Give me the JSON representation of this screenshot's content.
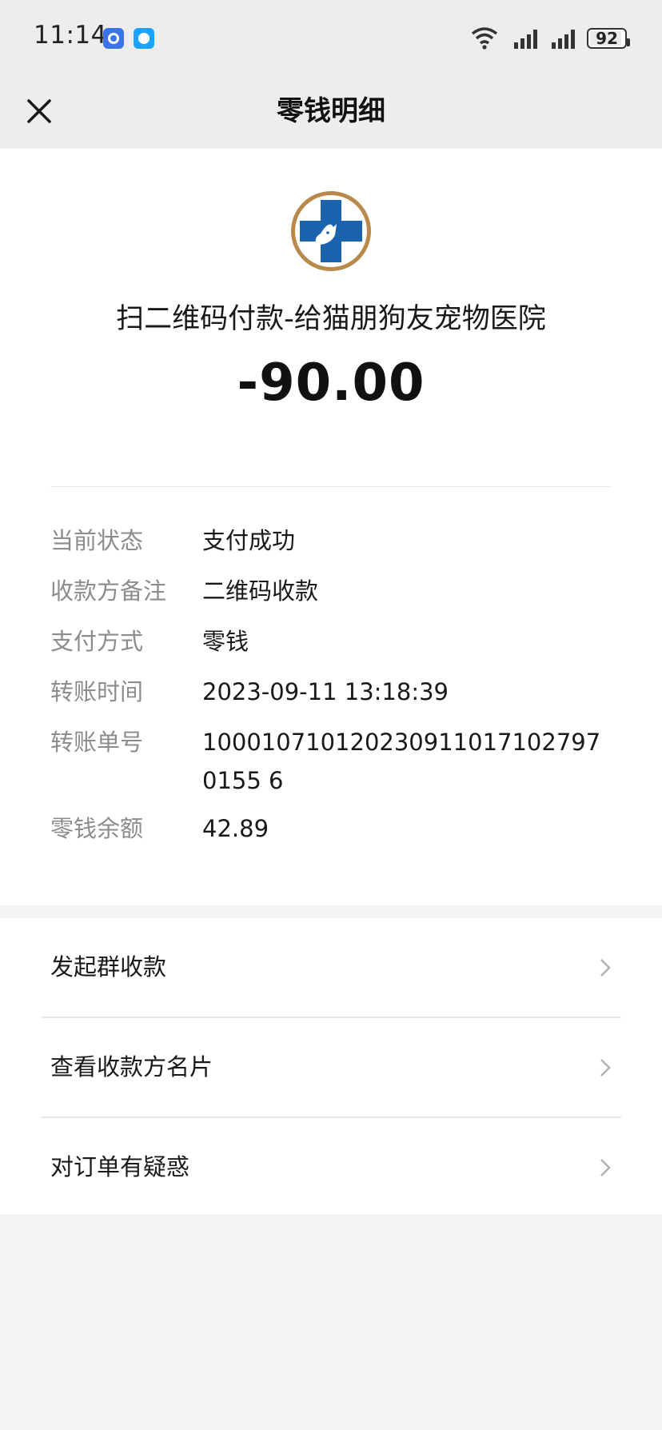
{
  "status_bar": {
    "time": "11:14",
    "battery": "92",
    "battery_level": 0.92,
    "notification_icons": [
      "app-shield-icon",
      "chat-bubble-icon"
    ]
  },
  "nav": {
    "title": "零钱明细",
    "close_icon": "close-icon"
  },
  "transaction": {
    "merchant_logo_icon": "pet-hospital-cross-logo",
    "merchant": "扫二维码付款-给猫朋狗友宠物医院",
    "amount": "-90.00"
  },
  "details": [
    {
      "label": "当前状态",
      "value": "支付成功"
    },
    {
      "label": "收款方备注",
      "value": "二维码收款"
    },
    {
      "label": "支付方式",
      "value": "零钱"
    },
    {
      "label": "转账时间",
      "value": "2023-09-11 13:18:39"
    },
    {
      "label": "转账单号",
      "value": "1000107101202309110171027970155 6"
    },
    {
      "label": "零钱余额",
      "value": "42.89"
    }
  ],
  "actions": [
    {
      "label": "发起群收款"
    },
    {
      "label": "查看收款方名片"
    },
    {
      "label": "对订单有疑惑"
    }
  ],
  "colors": {
    "header_bg": "#ededed",
    "page_bg": "#f5f5f5",
    "logo_ring": "#b8894b",
    "logo_blue": "#1b63ad"
  }
}
